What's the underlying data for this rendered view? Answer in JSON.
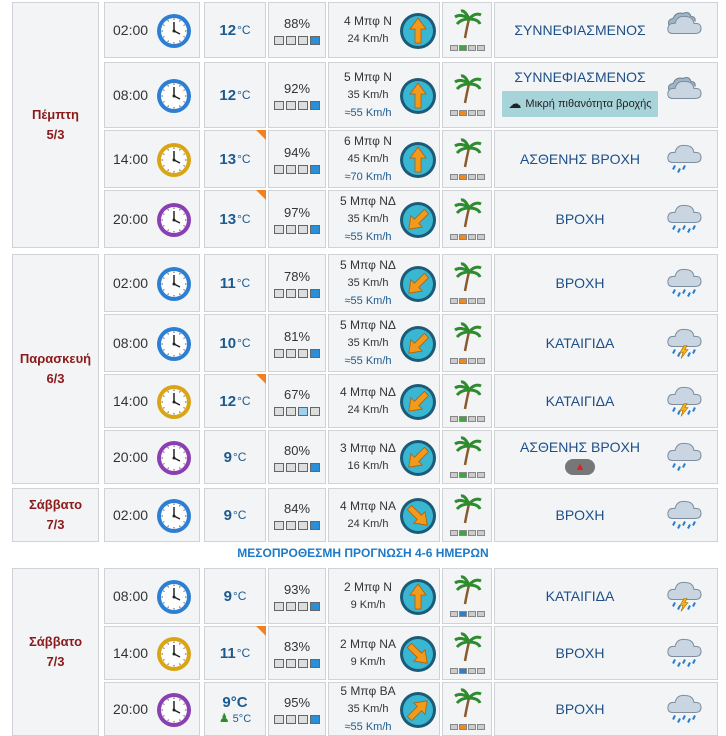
{
  "section_title": "ΜΕΣΟΠΡΟΘΕΣΜΗ ΠΡΟΓΝΩΣΗ 4-6 ΗΜΕΡΩΝ",
  "days": [
    {
      "name": "Πέμπτη",
      "date": "5/3"
    },
    {
      "name": "Παρασκευή",
      "date": "6/3"
    },
    {
      "name": "Σάββατο",
      "date": "7/3"
    },
    {
      "name": "Σάββατο",
      "date": "7/3"
    }
  ],
  "temp_unit": "°C",
  "rows": [
    {
      "time": "02:00",
      "clock": "blue",
      "temp": "12",
      "hum": "88%",
      "hum_level": 4,
      "wind_bf": "4 Μπφ Ν",
      "wind_kmh": "24 Km/h",
      "gust": "",
      "dir": "N",
      "bf_level": "g",
      "desc": "ΣΥΝΝΕΦΙΑΣΜΕΝΟΣ",
      "icon": "cloudy-icon",
      "badge": ""
    },
    {
      "time": "08:00",
      "clock": "blue",
      "temp": "12",
      "hum": "92%",
      "hum_level": 4,
      "wind_bf": "5 Μπφ Ν",
      "wind_kmh": "35 Km/h",
      "gust": "55 Km/h",
      "dir": "N",
      "bf_level": "o",
      "desc": "ΣΥΝΝΕΦΙΑΣΜΕΝΟΣ",
      "icon": "cloudy-icon",
      "badge": "Μικρή πιθανότητα βροχής"
    },
    {
      "time": "14:00",
      "clock": "gold",
      "temp": "13",
      "hum": "94%",
      "hum_level": 4,
      "wind_bf": "6 Μπφ Ν",
      "wind_kmh": "45 Km/h",
      "gust": "70 Km/h",
      "dir": "N",
      "bf_level": "o",
      "desc": "ΑΣΘΕΝΗΣ ΒΡΟΧΗ",
      "icon": "light-rain-icon",
      "badge": "",
      "corner": true
    },
    {
      "time": "20:00",
      "clock": "purple",
      "temp": "13",
      "hum": "97%",
      "hum_level": 4,
      "wind_bf": "5 Μπφ ΝΔ",
      "wind_kmh": "35 Km/h",
      "gust": "55 Km/h",
      "dir": "SW",
      "bf_level": "o",
      "desc": "ΒΡΟΧΗ",
      "icon": "rain-icon",
      "badge": "",
      "corner": true
    },
    {
      "time": "02:00",
      "clock": "blue",
      "temp": "11",
      "hum": "78%",
      "hum_level": 4,
      "wind_bf": "5 Μπφ ΝΔ",
      "wind_kmh": "35 Km/h",
      "gust": "55 Km/h",
      "dir": "SW",
      "bf_level": "o",
      "desc": "ΒΡΟΧΗ",
      "icon": "rain-icon",
      "badge": ""
    },
    {
      "time": "08:00",
      "clock": "blue",
      "temp": "10",
      "hum": "81%",
      "hum_level": 4,
      "wind_bf": "5 Μπφ ΝΔ",
      "wind_kmh": "35 Km/h",
      "gust": "55 Km/h",
      "dir": "SW",
      "bf_level": "o",
      "desc": "ΚΑΤΑΙΓΙΔΑ",
      "icon": "storm-icon",
      "badge": ""
    },
    {
      "time": "14:00",
      "clock": "gold",
      "temp": "12",
      "hum": "67%",
      "hum_level": 3,
      "wind_bf": "4 Μπφ ΝΔ",
      "wind_kmh": "24 Km/h",
      "gust": "",
      "dir": "SW",
      "bf_level": "g",
      "desc": "ΚΑΤΑΙΓΙΔΑ",
      "icon": "storm-icon",
      "badge": "",
      "corner": true
    },
    {
      "time": "20:00",
      "clock": "purple",
      "temp": "9",
      "hum": "80%",
      "hum_level": 4,
      "wind_bf": "3 Μπφ ΝΔ",
      "wind_kmh": "16 Km/h",
      "gust": "",
      "dir": "SW",
      "bf_level": "g",
      "desc": "ΑΣΘΕΝΗΣ ΒΡΟΧΗ",
      "icon": "light-rain-icon",
      "badge": "",
      "warn": true
    },
    {
      "time": "02:00",
      "clock": "blue",
      "temp": "9",
      "hum": "84%",
      "hum_level": 4,
      "wind_bf": "4 Μπφ ΝΑ",
      "wind_kmh": "24 Km/h",
      "gust": "",
      "dir": "SE",
      "bf_level": "g",
      "desc": "ΒΡΟΧΗ",
      "icon": "rain-icon",
      "badge": ""
    },
    {
      "time": "08:00",
      "clock": "blue",
      "temp": "9",
      "hum": "93%",
      "hum_level": 4,
      "wind_bf": "2 Μπφ Ν",
      "wind_kmh": "9 Km/h",
      "gust": "",
      "dir": "N",
      "bf_level": "b",
      "desc": "ΚΑΤΑΙΓΙΔΑ",
      "icon": "storm-icon",
      "badge": ""
    },
    {
      "time": "14:00",
      "clock": "gold",
      "temp": "11",
      "hum": "83%",
      "hum_level": 4,
      "wind_bf": "2 Μπφ ΝΑ",
      "wind_kmh": "9 Km/h",
      "gust": "",
      "dir": "SE",
      "bf_level": "b",
      "desc": "ΒΡΟΧΗ",
      "icon": "rain-icon",
      "badge": "",
      "corner": true
    },
    {
      "time": "20:00",
      "clock": "purple",
      "temp": "9°C",
      "feel": "5°C",
      "hum": "95%",
      "hum_level": 4,
      "wind_bf": "5 Μπφ ΒΑ",
      "wind_kmh": "35 Km/h",
      "gust": "55 Km/h",
      "dir": "NE",
      "bf_level": "o",
      "desc": "ΒΡΟΧΗ",
      "icon": "rain-icon",
      "badge": ""
    }
  ]
}
